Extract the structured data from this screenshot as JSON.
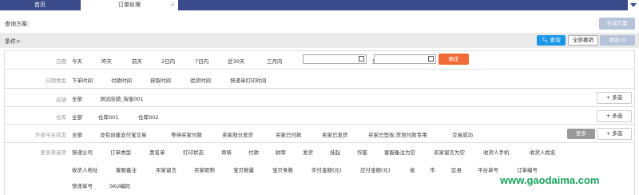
{
  "tabs": {
    "home": "首页",
    "order": "订单处理",
    "close": "×"
  },
  "plan": {
    "label": "查询方案:",
    "generate": "生成方案"
  },
  "conditions": {
    "label": "条件>",
    "query": "查询",
    "undo_all": "全部撤销",
    "collapse": "收起"
  },
  "date": {
    "label": "日期",
    "options": [
      "今天",
      "昨天",
      "前天",
      "2日内",
      "7日内",
      "近30天",
      "三月内"
    ],
    "separator": "至",
    "confirm": "确定"
  },
  "date_type": {
    "label": "日期类型",
    "options": [
      "下单时间",
      "付款时间",
      "获取时间",
      "验货时间",
      "快递单打印时间"
    ]
  },
  "shop": {
    "label": "店铺",
    "options": [
      "全部",
      "测试店铺_淘宝001"
    ]
  },
  "warehouse": {
    "label": "仓库",
    "options": [
      "全部",
      "仓库001",
      "仓库002"
    ]
  },
  "platform_status": {
    "label": "外部平台状态",
    "options": [
      "全部",
      "没有创建支付宝交易",
      "等待买家付款",
      "卖家部分发货",
      "买家已付款",
      "卖家已发货",
      "买家已签收,货到付款专用",
      "交易成功"
    ],
    "more": "更多"
  },
  "more_filters": {
    "label": "更多筛选项",
    "line1": [
      "快递公司",
      "订单类型",
      "黑名单",
      "打印状态",
      "审核",
      "付款",
      "财审",
      "发货",
      "挂起",
      "作废",
      "客服备注为空",
      "买家留言为空",
      "收货人手机",
      "收货人姓名"
    ],
    "line2": [
      "收货人地址",
      "客服备注",
      "买家留言",
      "买家昵称",
      "宝贝数量",
      "宝贝条数",
      "实付金额(元)",
      "应付金额(元)",
      "省",
      "市",
      "区县",
      "平台单号",
      "订单编号"
    ],
    "line3": [
      "快递单号",
      "SKU编码"
    ]
  },
  "multi_select": "多选",
  "watermark": "www.gaodaima.com",
  "colors": {
    "tabbar": "#3a4a8a",
    "query": "#1c97e8",
    "confirm": "#f26b36"
  }
}
